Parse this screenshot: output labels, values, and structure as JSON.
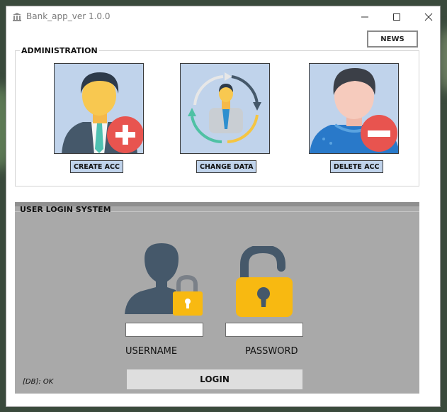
{
  "window": {
    "title": "Bank_app_ver 1.0.0"
  },
  "toolbar": {
    "news_label": "NEWS"
  },
  "administration": {
    "label": "ADMINISTRATION",
    "create_label": "CREATE ACC",
    "change_label": "CHANGE DATA",
    "delete_label": "DELETE ACC"
  },
  "login": {
    "label": "USER LOGIN SYSTEM",
    "username_label": "USERNAME",
    "password_label": "PASSWORD",
    "username_value": "",
    "password_value": "",
    "login_label": "LOGIN",
    "db_status": "[DB]: OK"
  },
  "colors": {
    "tile_bg": "#c0d3eb",
    "login_panel": "#a9a9a9",
    "lock_yellow": "#f8b911",
    "silhouette": "#45586a",
    "plus_red": "#e8544f"
  },
  "icons": [
    "bank-icon",
    "minimize-icon",
    "maximize-icon",
    "close-icon",
    "create-account-icon",
    "change-data-icon",
    "delete-account-icon",
    "user-lock-icon",
    "padlock-icon"
  ]
}
